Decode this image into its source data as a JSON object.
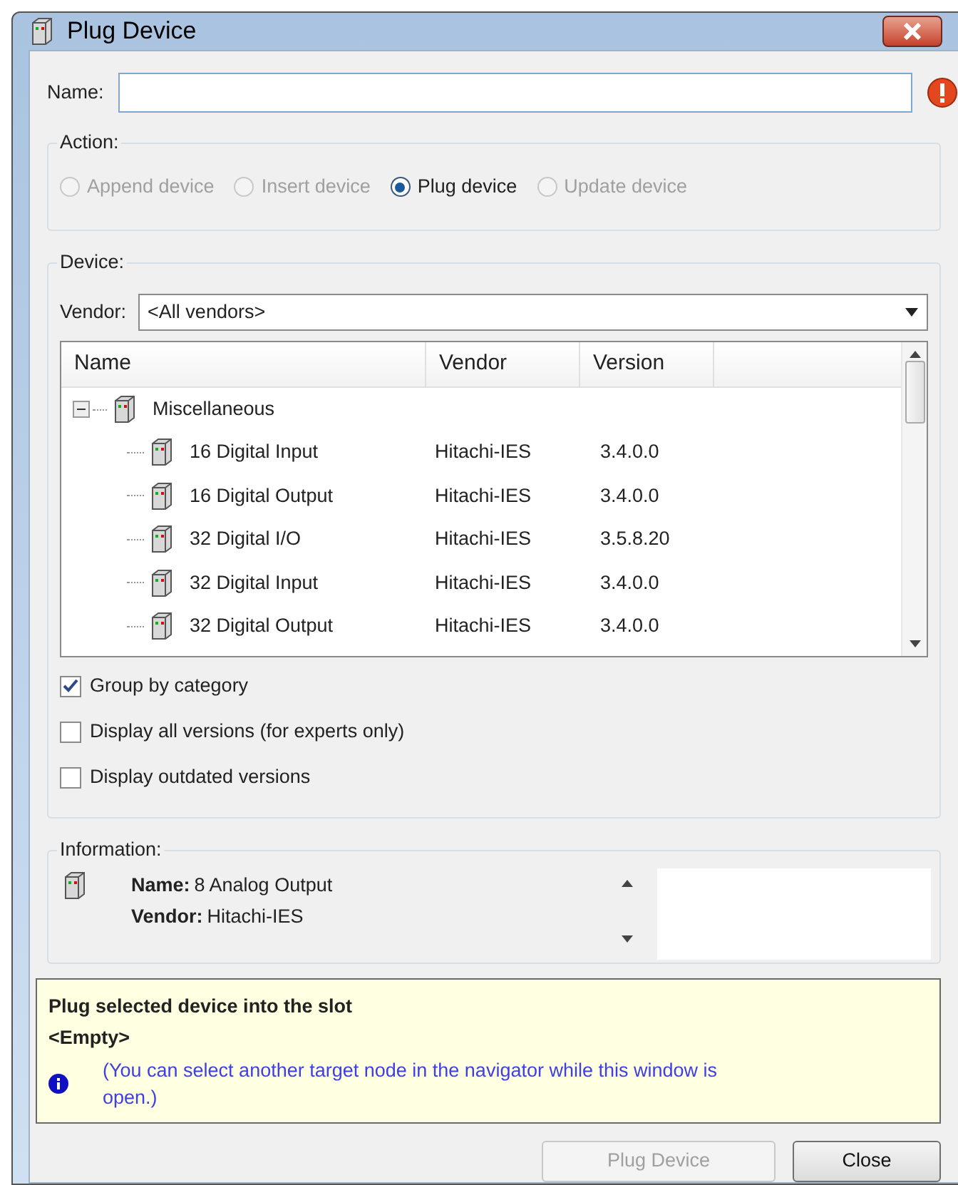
{
  "window": {
    "title": "Plug Device"
  },
  "name_field": {
    "label": "Name:",
    "error": true
  },
  "action": {
    "label": "Action:",
    "options": [
      {
        "label": "Append device",
        "selected": false,
        "disabled": true
      },
      {
        "label": "Insert device",
        "selected": false,
        "disabled": true
      },
      {
        "label": "Plug device",
        "selected": true,
        "disabled": false
      },
      {
        "label": "Update device",
        "selected": false,
        "disabled": true
      }
    ]
  },
  "device": {
    "label": "Device:",
    "vendor_label": "Vendor:",
    "vendor_value": "<All vendors>",
    "table": {
      "columns": [
        "Name",
        "Vendor",
        "Version"
      ],
      "rows": [
        {
          "name": "Miscellaneous",
          "expanded": true,
          "children": [
            {
              "name": "16 Digital Input",
              "vendor": "Hitachi-IES",
              "version": "3.4.0.0"
            },
            {
              "name": "16 Digital Output",
              "vendor": "Hitachi-IES",
              "version": "3.4.0.0"
            },
            {
              "name": "32 Digital I/O",
              "vendor": "Hitachi-IES",
              "version": "3.5.8.20"
            },
            {
              "name": "32 Digital Input",
              "vendor": "Hitachi-IES",
              "version": "3.4.0.0"
            },
            {
              "name": "32 Digital Output",
              "vendor": "Hitachi-IES",
              "version": "3.4.0.0"
            }
          ]
        }
      ]
    },
    "options": [
      {
        "label": "Group by category",
        "checked": true
      },
      {
        "label": "Display all versions (for experts only)",
        "checked": false
      },
      {
        "label": "Display outdated versions",
        "checked": false
      }
    ]
  },
  "information": {
    "label": "Information:",
    "name_label": "Name:",
    "name": "8 Analog Output",
    "vendor_label": "Vendor:",
    "vendor": "Hitachi-IES"
  },
  "message": {
    "title": "Plug selected device into the slot",
    "slot": "<Empty>",
    "hint": "(You can select another target node in the navigator while this window is open.)"
  },
  "buttons": [
    {
      "label": "Plug Device",
      "disabled": true
    },
    {
      "label": "Close",
      "disabled": false
    }
  ]
}
